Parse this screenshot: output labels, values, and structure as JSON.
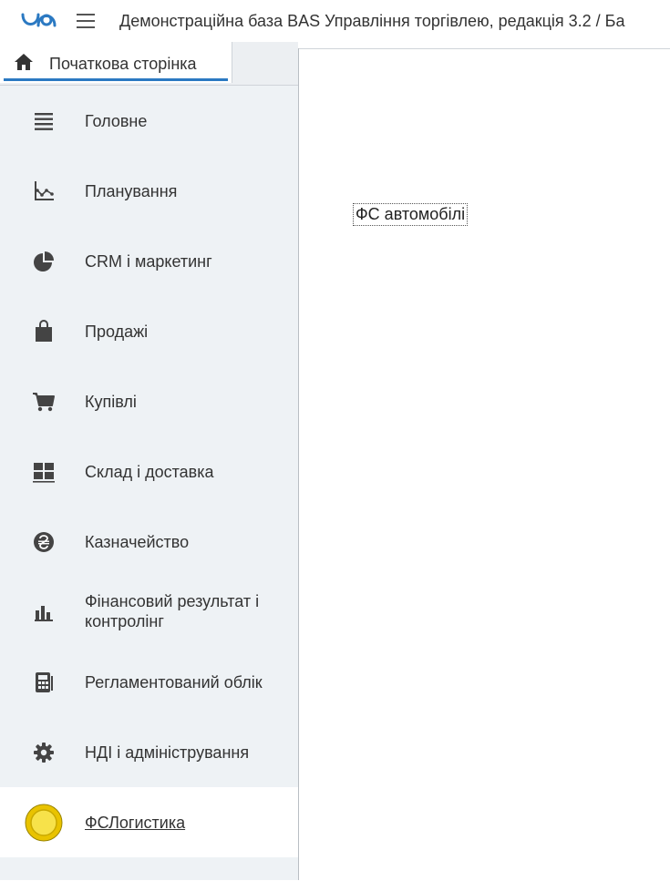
{
  "header": {
    "title": "Демонстраційна база BAS Управління торгівлею, редакція 3.2 / Ба"
  },
  "tabs": {
    "home_label": "Початкова сторінка"
  },
  "sidebar": {
    "items": [
      {
        "label": "Головне",
        "icon": "list-icon"
      },
      {
        "label": "Планування",
        "icon": "axes-chart-icon"
      },
      {
        "label": "CRM і маркетинг",
        "icon": "pie-chart-icon"
      },
      {
        "label": "Продажі",
        "icon": "shopping-bag-icon"
      },
      {
        "label": "Купівлі",
        "icon": "cart-icon"
      },
      {
        "label": "Склад і доставка",
        "icon": "warehouse-icon"
      },
      {
        "label": "Казначейство",
        "icon": "hryvnia-coin-icon"
      },
      {
        "label": "Фінансовий результат і контролінг",
        "icon": "bar-chart-icon"
      },
      {
        "label": "Регламентований облік",
        "icon": "calculator-icon"
      },
      {
        "label": "НДІ і адміністрування",
        "icon": "gear-icon"
      },
      {
        "label": "ФСЛогистика",
        "icon": "yellow-circle-icon"
      }
    ]
  },
  "content": {
    "link_label": "ФС автомобілі"
  },
  "colors": {
    "accent": "#2b79c2",
    "sidebar_bg": "#eef2f5",
    "active_bg": "#ffffff",
    "coin": "#f5d90a"
  }
}
